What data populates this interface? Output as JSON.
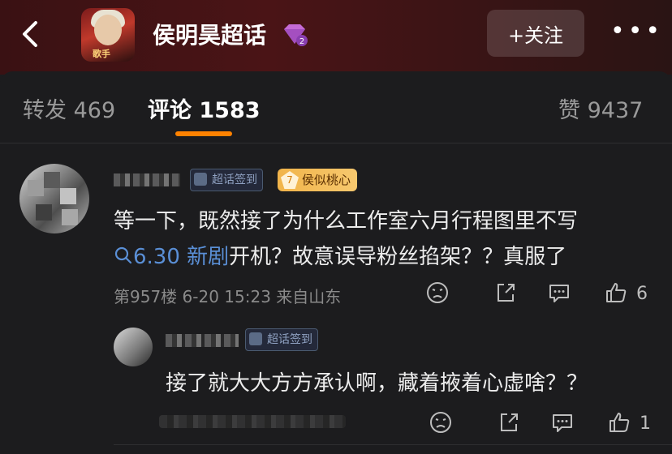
{
  "header": {
    "back_icon": "chevron-left-icon",
    "topic_title": "侯明昊超话",
    "avatar_text": "歌手",
    "badge_icon": "gem-level-2-icon",
    "follow_label": "+关注",
    "more_label": "•••"
  },
  "tabs": {
    "forward": "转发 469",
    "comments": "评论 1583",
    "likes": "赞 9437",
    "active_color": "#ff8200"
  },
  "comments": [
    {
      "sign_badge": "超话签到",
      "fan_level": "7",
      "fan_badge": "侯似桃心",
      "line1": "等一下，既然接了为什么工作室六月行程图里不写",
      "link_text": "6.30 新剧",
      "line2_rest": "开机？故意误导粉丝掐架？？真服了",
      "meta": "第957楼 6-20 15:23 来自山东",
      "like_count": "6"
    },
    {
      "sign_badge": "超话签到",
      "text": "接了就大大方方承认啊，藏着掖着心虚啥？？",
      "like_count": "1"
    }
  ],
  "colors": {
    "link": "#5a8fd6",
    "background": "#1c1c1e"
  }
}
